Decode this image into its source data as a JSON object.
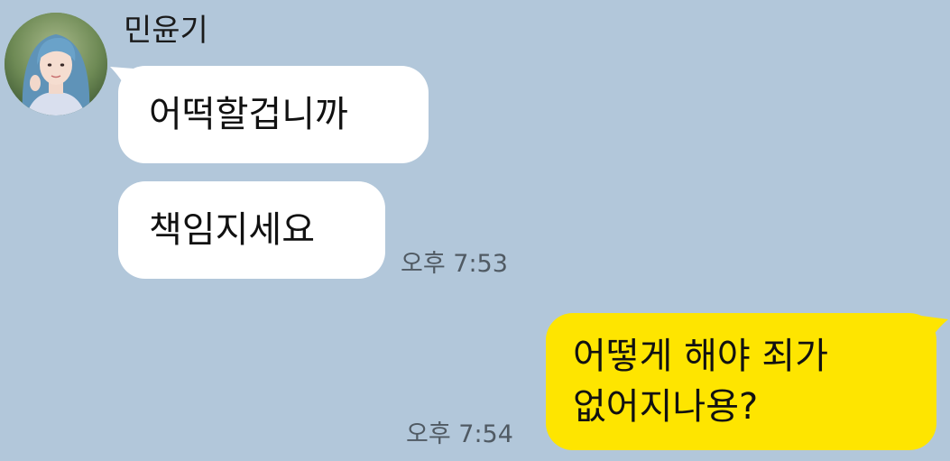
{
  "contact": {
    "name": "민윤기",
    "avatar_icon": "profile-photo"
  },
  "messages": [
    {
      "side": "incoming",
      "text": "어떡할겁니까"
    },
    {
      "side": "incoming",
      "text": "책임지세요",
      "time": "오후 7:53"
    },
    {
      "side": "outgoing",
      "lines": [
        "어떻게 해야 죄가",
        "없어지나용?"
      ],
      "time": "오후 7:54"
    }
  ],
  "colors": {
    "background": "#b2c7da",
    "incoming_bubble": "#ffffff",
    "outgoing_bubble": "#fee500",
    "timestamp": "#505a63"
  }
}
